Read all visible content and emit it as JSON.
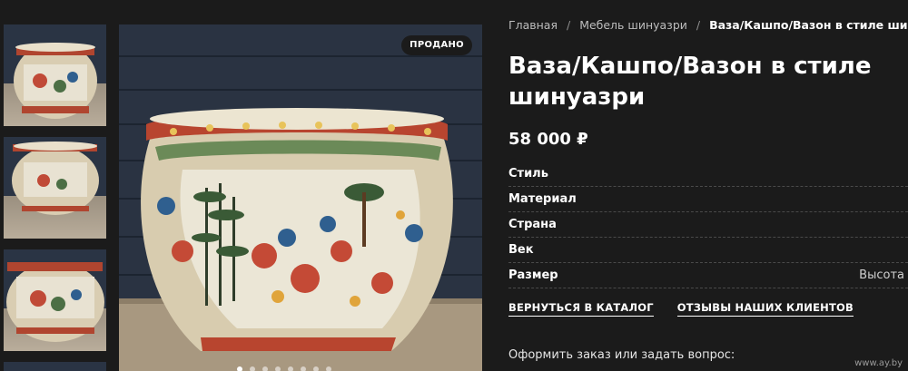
{
  "gallery": {
    "badge": "ПРОДАНО",
    "thumbnail_count": 4,
    "slide_count": 8,
    "active_slide": 1
  },
  "breadcrumb": {
    "home": "Главная",
    "separator": "/",
    "category": "Мебель шинуазри",
    "current": "Ваза/Кашпо/Вазон в стиле шинуазри"
  },
  "product": {
    "title": "Ваза/Кашпо/Вазон в стиле шинуазри",
    "price": "58 000 ₽",
    "properties": [
      {
        "label": "Стиль",
        "value": ""
      },
      {
        "label": "Материал",
        "value": ""
      },
      {
        "label": "Страна",
        "value": ""
      },
      {
        "label": "Век",
        "value": ""
      },
      {
        "label": "Размер",
        "value": "Высота"
      }
    ]
  },
  "actions": {
    "back_to_catalog": "ВЕРНУТЬСЯ В КАТАЛОГ",
    "reviews": "ОТЗЫВЫ НАШИХ КЛИЕНТОВ"
  },
  "order": {
    "prompt": "Оформить заказ или задать вопрос:"
  },
  "watermark": "www.ay.by",
  "colors": {
    "background": "#1b1b1b",
    "text": "#ffffff",
    "muted": "#bdbdbd",
    "badge_bg": "#1b1b1b"
  }
}
